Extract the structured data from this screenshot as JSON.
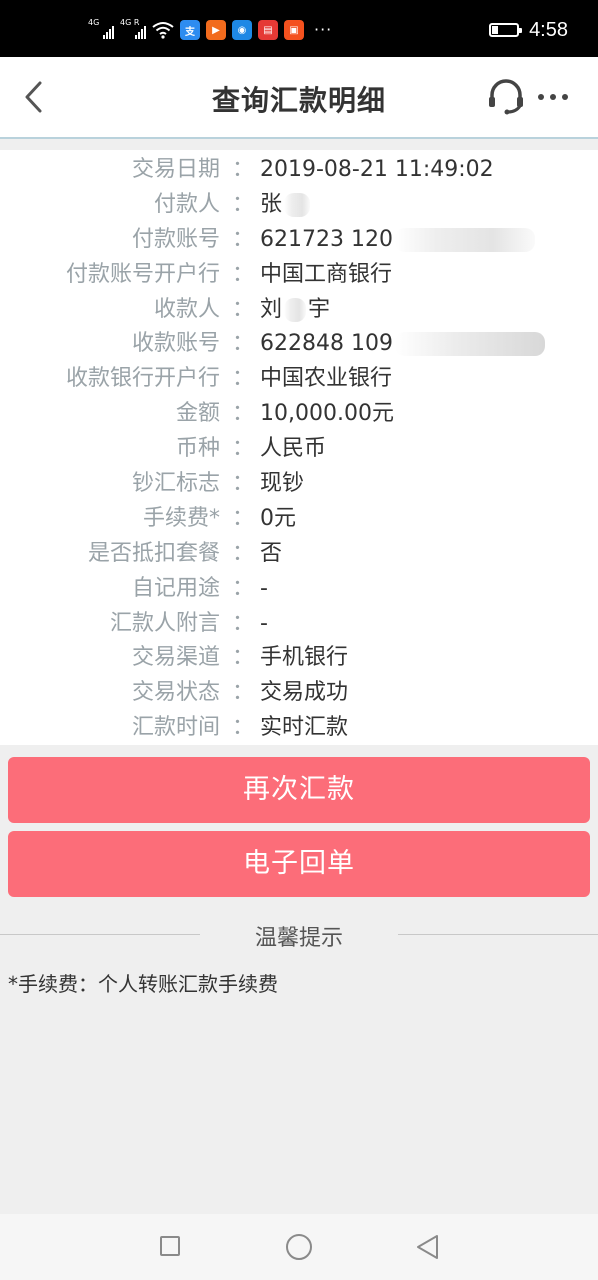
{
  "status_bar": {
    "signal_1_tag": "4G",
    "signal_2_tag": "4G R",
    "app_icons": [
      "alipay-icon",
      "play-icon",
      "wifi-share-icon",
      "reader-icon",
      "news-icon"
    ],
    "more": "···",
    "time": "4:58"
  },
  "header": {
    "title": "查询汇款明细",
    "back_icon": "chevron-left-icon",
    "service_icon": "headset-icon",
    "more_icon": "more-dots-icon"
  },
  "details": [
    {
      "label": "交易日期",
      "value": "2019-08-21 11:49:02",
      "blur": ""
    },
    {
      "label": "付款人",
      "value": "张",
      "blur": "short"
    },
    {
      "label": "付款账号",
      "value": "621723 120",
      "blur": "long"
    },
    {
      "label": "付款账号开户行",
      "value": "中国工商银行",
      "blur": ""
    },
    {
      "label": "收款人",
      "value": "刘",
      "value_tail": "宇",
      "blur": "mid"
    },
    {
      "label": "收款账号",
      "value": "622848 109",
      "blur": "long-dark"
    },
    {
      "label": "收款银行开户行",
      "value": "中国农业银行",
      "blur": ""
    },
    {
      "label": "金额",
      "value": "10,000.00元",
      "blur": ""
    },
    {
      "label": "币种",
      "value": "人民币",
      "blur": ""
    },
    {
      "label": "钞汇标志",
      "value": "现钞",
      "blur": ""
    },
    {
      "label": "手续费*",
      "value": "0元",
      "blur": ""
    },
    {
      "label": "是否抵扣套餐",
      "value": "否",
      "blur": ""
    },
    {
      "label": "自记用途",
      "value": "-",
      "blur": ""
    },
    {
      "label": "汇款人附言",
      "value": "-",
      "blur": ""
    },
    {
      "label": "交易渠道",
      "value": "手机银行",
      "blur": ""
    },
    {
      "label": "交易状态",
      "value": "交易成功",
      "blur": ""
    },
    {
      "label": "汇款时间",
      "value": "实时汇款",
      "blur": ""
    }
  ],
  "colon": "：",
  "buttons": {
    "remit_again": "再次汇款",
    "e_receipt": "电子回单"
  },
  "tips": {
    "title": "温馨提示",
    "text": "*手续费：个人转账汇款手续费"
  },
  "colors": {
    "accent_button": "#fc6d79",
    "label_gray": "#9aa3a8",
    "header_border": "#b9d2dc"
  }
}
